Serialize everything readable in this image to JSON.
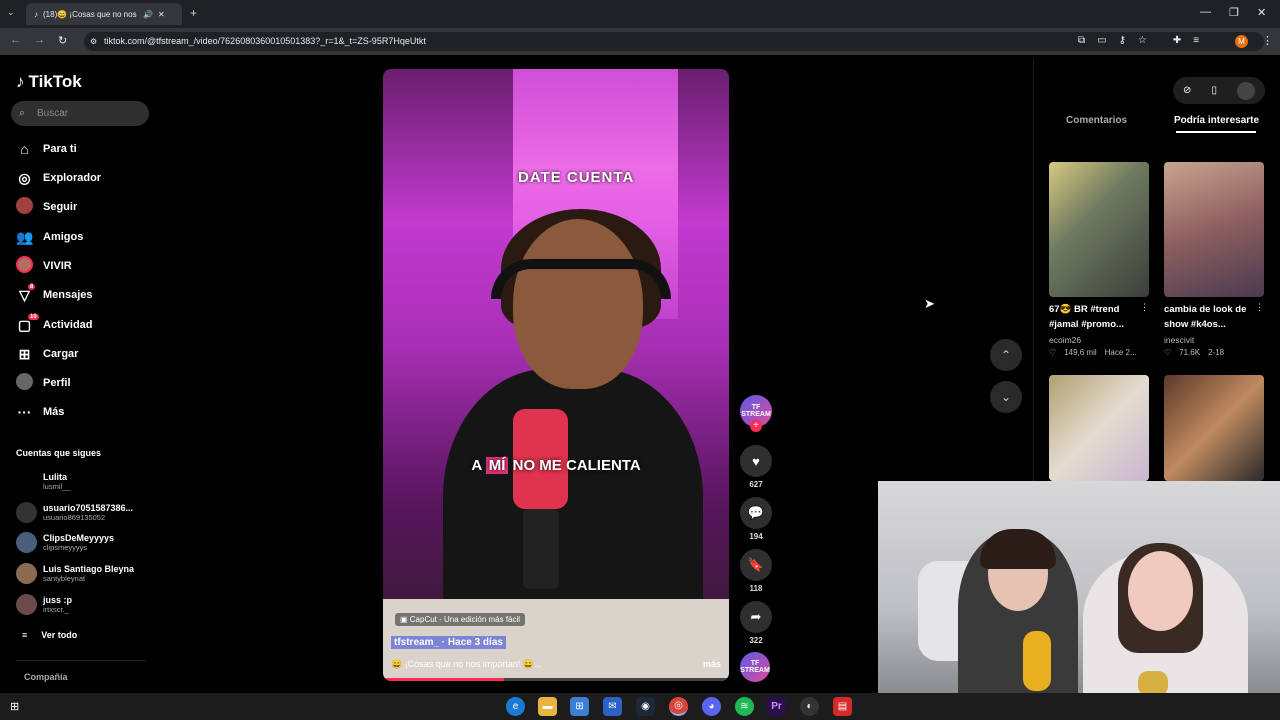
{
  "browser": {
    "tab_title": "(18)😄 ¡Cosas que no nos i",
    "url": "tiktok.com/@tfstream_/video/7626080360010501383?_r=1&_t=ZS-95R7HqeUtkt",
    "profile_initial": "M"
  },
  "sidebar": {
    "logo": "TikTok",
    "search_placeholder": "Buscar",
    "nav": [
      {
        "label": "Para ti",
        "icon": "home-icon"
      },
      {
        "label": "Explorador",
        "icon": "compass-icon"
      },
      {
        "label": "Seguir",
        "icon": "following-avatar-icon"
      },
      {
        "label": "Amigos",
        "icon": "friends-icon"
      },
      {
        "label": "VIVIR",
        "icon": "live-avatar-icon"
      },
      {
        "label": "Mensajes",
        "icon": "messages-icon",
        "badge": "8"
      },
      {
        "label": "Actividad",
        "icon": "activity-icon",
        "badge": "10"
      },
      {
        "label": "Cargar",
        "icon": "upload-icon"
      },
      {
        "label": "Perfil",
        "icon": "profile-avatar-icon"
      },
      {
        "label": "Más",
        "icon": "more-icon"
      }
    ],
    "following_title": "Cuentas que sigues",
    "following": [
      {
        "name": "Lulita",
        "handle": "lusmil__"
      },
      {
        "name": "usuario7051587386...",
        "handle": "usuario869135052"
      },
      {
        "name": "ClipsDeMeyyyys",
        "handle": "clipsmeyyyys"
      },
      {
        "name": "Luis Santiago Bleyna",
        "handle": "santybleynat"
      },
      {
        "name": "juss :p",
        "handle": "irtxscr._"
      }
    ],
    "see_all": "Ver todo",
    "company": "Compañía"
  },
  "video": {
    "sign_text": "DATE CUENTA",
    "caption_pre": "A",
    "caption_highlight": "MÍ",
    "caption_post": "NO ME CALIENTA",
    "capcut": "CapCut - Una edición más fácil",
    "author": "tfstream_ · Hace 3 días",
    "description": "😄 ¡Cosas que no nos importan! 😄...",
    "more": "más"
  },
  "actions": {
    "likes": "627",
    "comments": "194",
    "saves": "118",
    "shares": "322",
    "avatar_text": "TF STREAM"
  },
  "right_panel": {
    "tabs": [
      "Comentarios",
      "Podría interesarte"
    ],
    "recommendations": [
      {
        "title": "67😎 BR #trend #jamal #promo...",
        "author": "ecoim26",
        "likes": "149,6 mil",
        "date": "Hace 2..."
      },
      {
        "title": "cambia de look de show #k4os...",
        "author": "inescivit",
        "likes": "71.6K",
        "date": "2-18"
      }
    ]
  },
  "colors": {
    "accent": "#fe2c55",
    "background": "#000000",
    "panel": "#2f2f2f"
  }
}
